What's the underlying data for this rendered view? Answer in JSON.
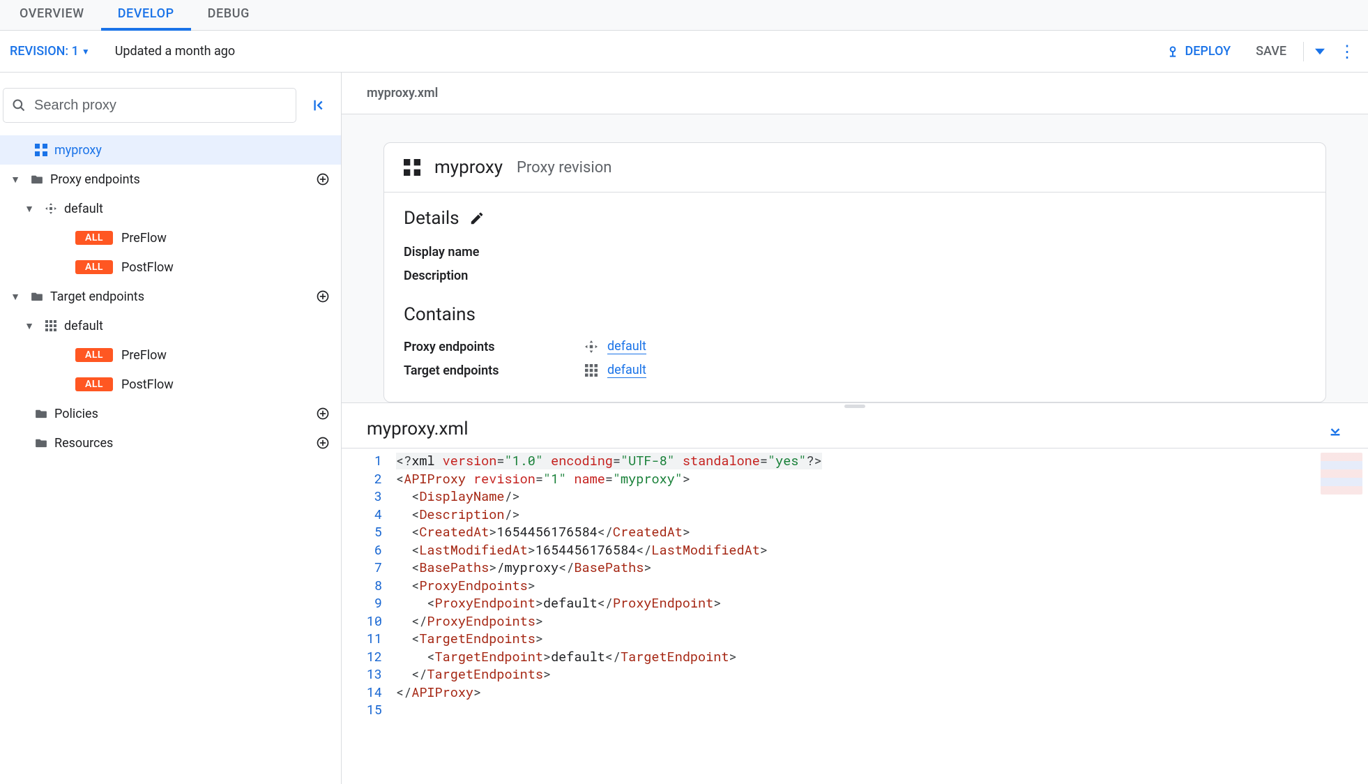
{
  "tabs": {
    "overview": "OVERVIEW",
    "develop": "DEVELOP",
    "debug": "DEBUG",
    "active": "develop"
  },
  "revision": {
    "label": "REVISION: 1",
    "updated": "Updated a month ago"
  },
  "actions": {
    "deploy": "DEPLOY",
    "save": "SAVE"
  },
  "search": {
    "placeholder": "Search proxy"
  },
  "tree": {
    "root": {
      "label": "myproxy"
    },
    "proxy_endpoints": {
      "label": "Proxy endpoints",
      "default": {
        "label": "default",
        "preflow": {
          "badge": "ALL",
          "label": "PreFlow"
        },
        "postflow": {
          "badge": "ALL",
          "label": "PostFlow"
        }
      }
    },
    "target_endpoints": {
      "label": "Target endpoints",
      "default": {
        "label": "default",
        "preflow": {
          "badge": "ALL",
          "label": "PreFlow"
        },
        "postflow": {
          "badge": "ALL",
          "label": "PostFlow"
        }
      }
    },
    "policies": {
      "label": "Policies"
    },
    "resources": {
      "label": "Resources"
    }
  },
  "breadcrumb": "myproxy.xml",
  "card": {
    "title": "myproxy",
    "subtitle": "Proxy revision",
    "details_heading": "Details",
    "display_name_label": "Display name",
    "description_label": "Description",
    "contains_heading": "Contains",
    "proxy_endpoints_label": "Proxy endpoints",
    "proxy_endpoints_value": "default",
    "target_endpoints_label": "Target endpoints",
    "target_endpoints_value": "default"
  },
  "editor": {
    "title": "myproxy.xml"
  },
  "xml": {
    "version": "1.0",
    "encoding": "UTF-8",
    "standalone": "yes",
    "revision": "1",
    "name": "myproxy",
    "createdAt": "1654456176584",
    "lastModifiedAt": "1654456176584",
    "basePaths": "/myproxy",
    "proxyEndpoint": "default",
    "targetEndpoint": "default"
  }
}
